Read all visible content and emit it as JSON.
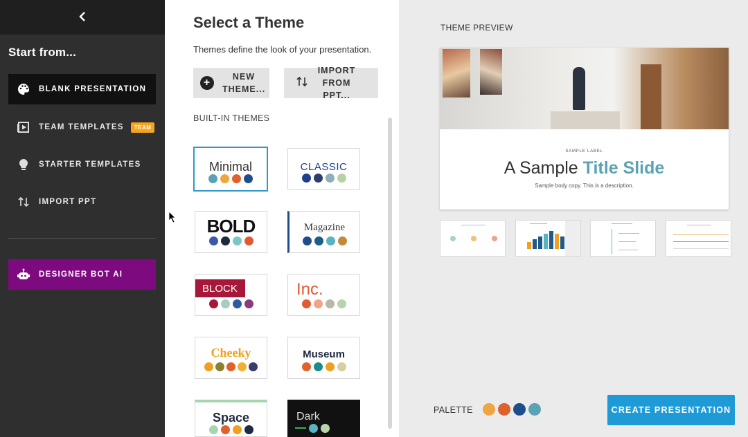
{
  "sidebar": {
    "back_label": "‹",
    "start_label": "Start from...",
    "items": [
      {
        "label": "BLANK PRESENTATION",
        "icon": "palette-icon"
      },
      {
        "label": "TEAM TEMPLATES",
        "icon": "template-icon",
        "badge": "TEAM"
      },
      {
        "label": "STARTER TEMPLATES",
        "icon": "lightbulb-icon"
      },
      {
        "label": "IMPORT PPT",
        "icon": "import-arrows-icon"
      },
      {
        "label": "DESIGNER BOT AI",
        "icon": "robot-icon"
      }
    ]
  },
  "themes_panel": {
    "title": "Select a Theme",
    "description": "Themes define the look of your presentation.",
    "new_theme_label": "NEW THEME...",
    "import_label": "IMPORT FROM PPT...",
    "builtin_label": "BUILT-IN THEMES",
    "themes": [
      {
        "name": "Minimal",
        "colors": [
          "#5aa3b5",
          "#f0a640",
          "#e0602e",
          "#1f4d8c"
        ]
      },
      {
        "name": "CLASSIC",
        "colors": [
          "#1f3f8c",
          "#2d3e6b",
          "#8bb0b5",
          "#b8d0a8"
        ]
      },
      {
        "name": "BOLD",
        "colors": [
          "#3a5aa8",
          "#1e2a40",
          "#7cc6c6",
          "#e05a34"
        ]
      },
      {
        "name": "Magazine",
        "colors": [
          "#1f4d8c",
          "#1b5c8a",
          "#5ab3c0",
          "#c08c3c"
        ]
      },
      {
        "name": "BLOCK",
        "colors": [
          "#a6173a",
          "#a8cdc0",
          "#2d5aa0",
          "#8b3a7a"
        ]
      },
      {
        "name": "Inc.",
        "colors": [
          "#e05a34",
          "#f0a48c",
          "#b8b8a8",
          "#b8d4a8"
        ]
      },
      {
        "name": "Cheeky",
        "colors": [
          "#f0a020",
          "#8b8030",
          "#e0602e",
          "#f0b030",
          "#3a3a6b"
        ]
      },
      {
        "name": "Museum",
        "colors": [
          "#e0602e",
          "#1a8c8c",
          "#f0a020",
          "#d4d0a0"
        ]
      },
      {
        "name": "Space",
        "colors": [
          "#a8d4b0",
          "#e0602e",
          "#f0a020",
          "#1e2a40"
        ]
      },
      {
        "name": "Dark",
        "colors": [
          "#3ab050",
          "#5ab3c0",
          "#b8d4a8"
        ]
      }
    ]
  },
  "preview": {
    "title": "THEME PREVIEW",
    "slide_label": "SAMPLE LABEL",
    "slide_title_plain": "A Sample ",
    "slide_title_highlight": "Title Slide",
    "slide_body": "Sample body copy. This is a description.",
    "palette_label": "PALETTE",
    "palette_colors": [
      "#f0a640",
      "#e0602e",
      "#1f4d8c",
      "#5aa3b5"
    ],
    "create_label": "CREATE PRESENTATION"
  }
}
